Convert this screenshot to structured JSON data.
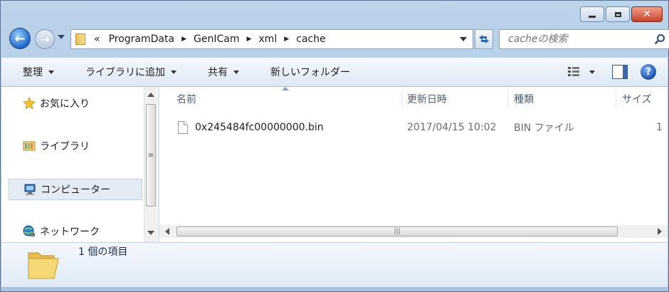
{
  "window": {
    "caption_buttons": {
      "minimize": "minimize",
      "maximize": "maximize",
      "close": "✕"
    }
  },
  "nav": {
    "back_icon": "back-arrow-icon",
    "forward_icon": "forward-arrow-icon"
  },
  "address": {
    "overflow": "«",
    "breadcrumbs": [
      "ProgramData",
      "GenICam",
      "xml",
      "cache"
    ]
  },
  "search": {
    "placeholder": "cacheの検索"
  },
  "toolbar": {
    "organize": "整理",
    "add_to_library": "ライブラリに追加",
    "share": "共有",
    "new_folder": "新しいフォルダー"
  },
  "sidebar": {
    "items": [
      {
        "label": "お気に入り",
        "icon": "star-icon"
      },
      {
        "label": "ライブラリ",
        "icon": "library-icon"
      },
      {
        "label": "コンピューター",
        "icon": "computer-icon"
      },
      {
        "label": "ネットワーク",
        "icon": "network-icon"
      }
    ]
  },
  "columns": {
    "name": "名前",
    "date": "更新日時",
    "type": "種類",
    "size": "サイズ"
  },
  "files": [
    {
      "name": "0x245484fc00000000.bin",
      "date": "2017/04/15 10:02",
      "type": "BIN ファイル",
      "size": "1"
    }
  ],
  "details": {
    "count": "1 個の項目"
  },
  "colors": {
    "accent": "#1f66c8",
    "close": "#c5432a"
  }
}
